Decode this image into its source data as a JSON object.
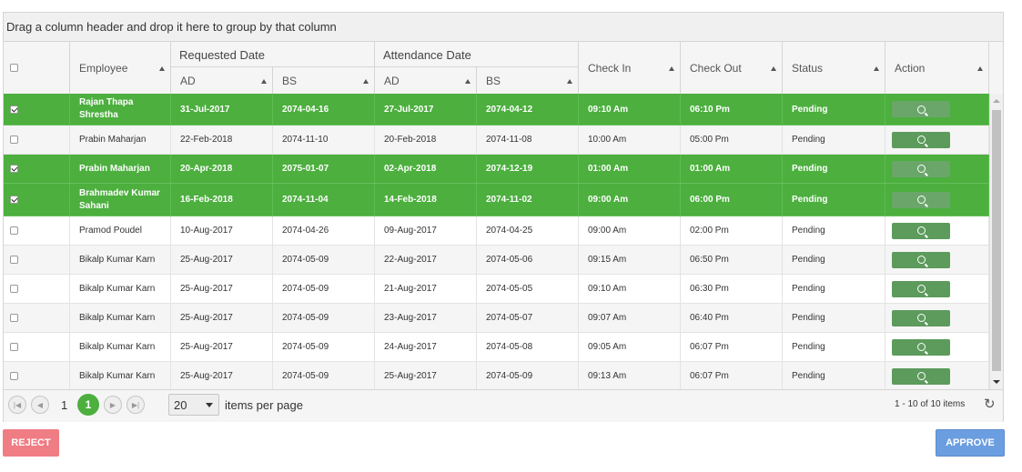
{
  "group_panel_text": "Drag a column header and drop it here to group by that column",
  "columns": {
    "employee": "Employee",
    "requested_date": "Requested Date",
    "attendance_date": "Attendance Date",
    "req_ad": "AD",
    "req_bs": "BS",
    "att_ad": "AD",
    "att_bs": "BS",
    "check_in": "Check In",
    "check_out": "Check Out",
    "status": "Status",
    "action": "Action"
  },
  "rows": [
    {
      "checked": true,
      "employee": "Rajan Thapa Shrestha",
      "req_ad": "31-Jul-2017",
      "req_bs": "2074-04-16",
      "att_ad": "27-Jul-2017",
      "att_bs": "2074-04-12",
      "check_in": "09:10 Am",
      "check_out": "06:10 Pm",
      "status": "Pending"
    },
    {
      "checked": false,
      "employee": "Prabin Maharjan",
      "req_ad": "22-Feb-2018",
      "req_bs": "2074-11-10",
      "att_ad": "20-Feb-2018",
      "att_bs": "2074-11-08",
      "check_in": "10:00 Am",
      "check_out": "05:00 Pm",
      "status": "Pending"
    },
    {
      "checked": true,
      "employee": "Prabin Maharjan",
      "req_ad": "20-Apr-2018",
      "req_bs": "2075-01-07",
      "att_ad": "02-Apr-2018",
      "att_bs": "2074-12-19",
      "check_in": "01:00 Am",
      "check_out": "01:00 Am",
      "status": "Pending"
    },
    {
      "checked": true,
      "employee": "Brahmadev Kumar Sahani",
      "req_ad": "16-Feb-2018",
      "req_bs": "2074-11-04",
      "att_ad": "14-Feb-2018",
      "att_bs": "2074-11-02",
      "check_in": "09:00 Am",
      "check_out": "06:00 Pm",
      "status": "Pending"
    },
    {
      "checked": false,
      "employee": "Pramod Poudel",
      "req_ad": "10-Aug-2017",
      "req_bs": "2074-04-26",
      "att_ad": "09-Aug-2017",
      "att_bs": "2074-04-25",
      "check_in": "09:00 Am",
      "check_out": "02:00 Pm",
      "status": "Pending"
    },
    {
      "checked": false,
      "employee": "Bikalp Kumar Karn",
      "req_ad": "25-Aug-2017",
      "req_bs": "2074-05-09",
      "att_ad": "22-Aug-2017",
      "att_bs": "2074-05-06",
      "check_in": "09:15 Am",
      "check_out": "06:50 Pm",
      "status": "Pending"
    },
    {
      "checked": false,
      "employee": "Bikalp Kumar Karn",
      "req_ad": "25-Aug-2017",
      "req_bs": "2074-05-09",
      "att_ad": "21-Aug-2017",
      "att_bs": "2074-05-05",
      "check_in": "09:10 Am",
      "check_out": "06:30 Pm",
      "status": "Pending"
    },
    {
      "checked": false,
      "employee": "Bikalp Kumar Karn",
      "req_ad": "25-Aug-2017",
      "req_bs": "2074-05-09",
      "att_ad": "23-Aug-2017",
      "att_bs": "2074-05-07",
      "check_in": "09:07 Am",
      "check_out": "06:40 Pm",
      "status": "Pending"
    },
    {
      "checked": false,
      "employee": "Bikalp Kumar Karn",
      "req_ad": "25-Aug-2017",
      "req_bs": "2074-05-09",
      "att_ad": "24-Aug-2017",
      "att_bs": "2074-05-08",
      "check_in": "09:05 Am",
      "check_out": "06:07 Pm",
      "status": "Pending"
    },
    {
      "checked": false,
      "employee": "Bikalp Kumar Karn",
      "req_ad": "25-Aug-2017",
      "req_bs": "2074-05-09",
      "att_ad": "25-Aug-2017",
      "att_bs": "2074-05-09",
      "check_in": "09:13 Am",
      "check_out": "06:07 Pm",
      "status": "Pending"
    }
  ],
  "pager": {
    "page_number": "1",
    "current_page": "1",
    "page_size": "20",
    "items_per_page_label": "items per page",
    "info": "1 - 10 of 10 items"
  },
  "buttons": {
    "reject": "REJECT",
    "approve": "APPROVE"
  },
  "colors": {
    "selected_row": "#4caf3e",
    "reject": "#f07c84",
    "approve": "#6b9ee0"
  }
}
